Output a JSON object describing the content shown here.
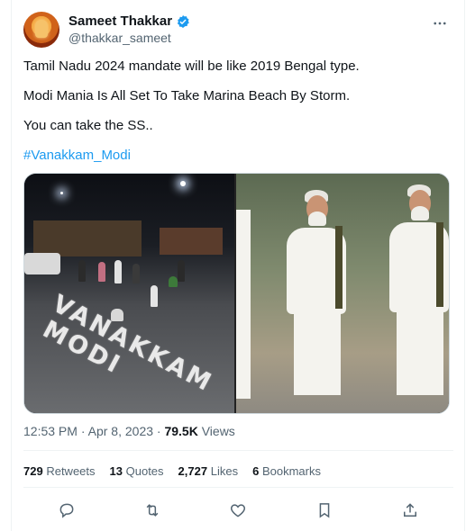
{
  "author": {
    "name": "Sameet Thakkar",
    "handle": "@thakkar_sameet"
  },
  "tweet": {
    "lines": [
      "Tamil Nadu 2024 mandate will be like 2019 Bengal type.",
      "Modi Mania Is All Set To Take Marina Beach By Storm.",
      "You can take the SS.."
    ],
    "hashtag": "#Vanakkam_Modi",
    "image_text": {
      "line1": "VANAKKAM",
      "line2": "MODI"
    }
  },
  "meta": {
    "time": "12:53 PM",
    "separator": "·",
    "date": "Apr 8, 2023",
    "views_count": "79.5K",
    "views_label": "Views"
  },
  "stats": {
    "retweets_count": "729",
    "retweets_label": "Retweets",
    "quotes_count": "13",
    "quotes_label": "Quotes",
    "likes_count": "2,727",
    "likes_label": "Likes",
    "bookmarks_count": "6",
    "bookmarks_label": "Bookmarks"
  },
  "colors": {
    "accent": "#1d9bf0",
    "muted": "#536471",
    "text": "#0f1419"
  },
  "icons": {
    "verified": "verified-badge-icon",
    "more": "more-horizontal-icon",
    "reply": "reply-icon",
    "retweet": "retweet-icon",
    "like": "heart-icon",
    "bookmark": "bookmark-icon",
    "share": "share-icon"
  }
}
